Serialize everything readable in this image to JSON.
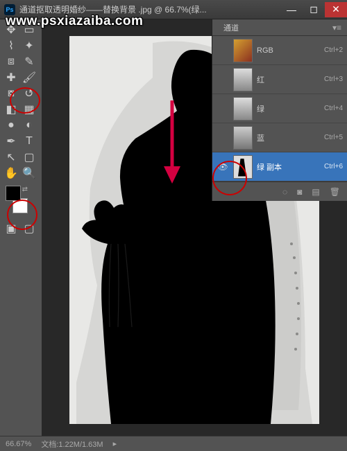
{
  "watermark": "www.psxiazaiba.com",
  "titlebar": {
    "title": "通道抠取透明婚纱——替换背景 .jpg @ 66.7%(绿...",
    "ps_label": "Ps"
  },
  "window": {
    "min": "—",
    "max": "◻",
    "close": "✕"
  },
  "channels": {
    "tab": "通道",
    "items": [
      {
        "name": "RGB",
        "shortcut": "Ctrl+2",
        "eye": false,
        "thumb": "rgb",
        "selected": false
      },
      {
        "name": "红",
        "shortcut": "Ctrl+3",
        "eye": false,
        "thumb": "r",
        "selected": false
      },
      {
        "name": "绿",
        "shortcut": "Ctrl+4",
        "eye": false,
        "thumb": "g",
        "selected": false
      },
      {
        "name": "蓝",
        "shortcut": "Ctrl+5",
        "eye": false,
        "thumb": "b",
        "selected": false
      },
      {
        "name": "绿 副本",
        "shortcut": "Ctrl+6",
        "eye": true,
        "thumb": "gc",
        "selected": true
      }
    ]
  },
  "status": {
    "zoom": "66.67%",
    "doc": "文档:1.22M/1.63M"
  },
  "tools": {
    "row1": [
      "move",
      "marquee"
    ],
    "row2": [
      "lasso",
      "wand"
    ],
    "row3": [
      "crop",
      "eyedrop"
    ],
    "row4": [
      "heal",
      "brush"
    ],
    "row5": [
      "stamp",
      "history"
    ],
    "row6": [
      "eraser",
      "gradient"
    ],
    "row7": [
      "blur",
      "dodge"
    ],
    "row8": [
      "pen",
      "type"
    ],
    "row9": [
      "path",
      "shape"
    ],
    "row10": [
      "hand",
      "zoom"
    ]
  },
  "footer_icons": [
    "mask",
    "new-channel",
    "link",
    "trash"
  ]
}
